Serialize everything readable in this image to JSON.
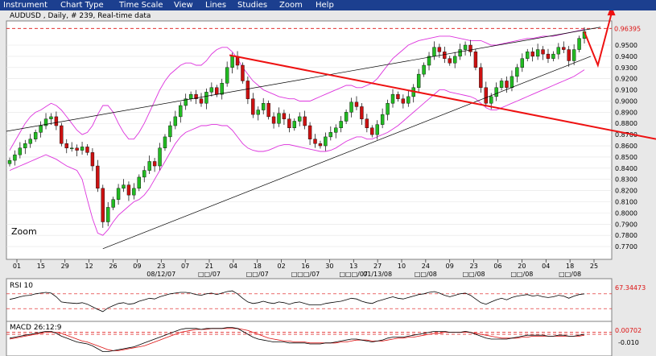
{
  "menu": [
    "Instrument",
    "Chart Type",
    "Time Scale",
    "View",
    "Lines",
    "Studies",
    "Zoom",
    "Help"
  ],
  "chart": {
    "title": "AUDUSD , Daily, # 239, Real-time data",
    "zoom_label": "Zoom",
    "last_price_label": "0.96395",
    "price_ticks": [
      "0.9500",
      "0.9400",
      "0.9300",
      "0.9200",
      "0.9100",
      "0.9000",
      "0.8900",
      "0.8800",
      "0.8700",
      "0.8600",
      "0.8500",
      "0.8400",
      "0.8300",
      "0.8200",
      "0.8100",
      "0.8000",
      "0.7900",
      "0.7800",
      "0.7700"
    ],
    "day_ticks": [
      "01",
      "15",
      "29",
      "12",
      "26",
      "09",
      "23",
      "07",
      "21",
      "04",
      "18",
      "02",
      "16",
      "30",
      "13",
      "27",
      "10",
      "24",
      "09",
      "23",
      "06",
      "20",
      "04",
      "18",
      "25"
    ],
    "month_labels": [
      "08/12/07",
      "□□/07",
      "□□/07",
      "□□□/07",
      "□□□/07",
      "01/13/08",
      "□□/08",
      "□□/08",
      "□□/08",
      "□□/08"
    ],
    "colors": {
      "up": "#22bb22",
      "down": "#cc1111",
      "band": "#dd33dd",
      "trend": "#ee1111",
      "wedge": "#000000"
    }
  },
  "rsi": {
    "label": "RSI 10",
    "value_label": "67.34473"
  },
  "macd": {
    "label": "MACD 26:12:9",
    "value_label": "0.00702",
    "low_label": "-0.010"
  },
  "chart_data": {
    "type": "candlestick",
    "instrument": "AUDUSD",
    "ylim": [
      0.765,
      0.968
    ],
    "closes": [
      0.847,
      0.852,
      0.858,
      0.862,
      0.866,
      0.872,
      0.878,
      0.884,
      0.886,
      0.878,
      0.862,
      0.858,
      0.858,
      0.856,
      0.859,
      0.854,
      0.842,
      0.822,
      0.792,
      0.805,
      0.812,
      0.822,
      0.825,
      0.816,
      0.822,
      0.832,
      0.838,
      0.846,
      0.842,
      0.858,
      0.868,
      0.878,
      0.886,
      0.896,
      0.902,
      0.906,
      0.902,
      0.898,
      0.908,
      0.912,
      0.906,
      0.916,
      0.93,
      0.94,
      0.932,
      0.918,
      0.902,
      0.888,
      0.892,
      0.898,
      0.886,
      0.88,
      0.889,
      0.884,
      0.876,
      0.882,
      0.886,
      0.878,
      0.866,
      0.862,
      0.86,
      0.868,
      0.872,
      0.876,
      0.882,
      0.89,
      0.899,
      0.895,
      0.884,
      0.876,
      0.87,
      0.879,
      0.888,
      0.898,
      0.906,
      0.902,
      0.898,
      0.904,
      0.912,
      0.924,
      0.932,
      0.94,
      0.948,
      0.944,
      0.938,
      0.934,
      0.94,
      0.946,
      0.95,
      0.944,
      0.93,
      0.912,
      0.898,
      0.904,
      0.912,
      0.918,
      0.912,
      0.922,
      0.93,
      0.938,
      0.944,
      0.94,
      0.946,
      0.942,
      0.938,
      0.942,
      0.948,
      0.946,
      0.936,
      0.946,
      0.956,
      0.962
    ],
    "upper_band": [
      0.856,
      0.864,
      0.872,
      0.88,
      0.886,
      0.89,
      0.892,
      0.895,
      0.898,
      0.896,
      0.892,
      0.886,
      0.88,
      0.874,
      0.87,
      0.872,
      0.878,
      0.888,
      0.896,
      0.896,
      0.89,
      0.88,
      0.872,
      0.866,
      0.866,
      0.872,
      0.88,
      0.89,
      0.9,
      0.91,
      0.918,
      0.924,
      0.928,
      0.932,
      0.934,
      0.934,
      0.932,
      0.932,
      0.936,
      0.942,
      0.946,
      0.948,
      0.948,
      0.944,
      0.938,
      0.93,
      0.924,
      0.918,
      0.914,
      0.91,
      0.908,
      0.906,
      0.904,
      0.903,
      0.902,
      0.902,
      0.9,
      0.9,
      0.9,
      0.902,
      0.904,
      0.906,
      0.908,
      0.91,
      0.912,
      0.914,
      0.914,
      0.912,
      0.912,
      0.914,
      0.916,
      0.92,
      0.926,
      0.932,
      0.938,
      0.942,
      0.946,
      0.95,
      0.952,
      0.954,
      0.955,
      0.956,
      0.957,
      0.958,
      0.958,
      0.958,
      0.957,
      0.956,
      0.955,
      0.954,
      0.954,
      0.954,
      0.952,
      0.95,
      0.95,
      0.951,
      0.952,
      0.953,
      0.954,
      0.955,
      0.956,
      0.956,
      0.957,
      0.958,
      0.958,
      0.958,
      0.959,
      0.96,
      0.961,
      0.962,
      0.963,
      0.964
    ],
    "lower_band": [
      0.838,
      0.84,
      0.842,
      0.844,
      0.846,
      0.848,
      0.85,
      0.852,
      0.85,
      0.848,
      0.845,
      0.842,
      0.84,
      0.838,
      0.83,
      0.812,
      0.795,
      0.782,
      0.78,
      0.785,
      0.792,
      0.798,
      0.802,
      0.806,
      0.81,
      0.812,
      0.816,
      0.822,
      0.83,
      0.838,
      0.846,
      0.854,
      0.862,
      0.868,
      0.872,
      0.874,
      0.876,
      0.878,
      0.878,
      0.879,
      0.879,
      0.878,
      0.878,
      0.874,
      0.868,
      0.862,
      0.858,
      0.856,
      0.855,
      0.855,
      0.856,
      0.858,
      0.86,
      0.861,
      0.861,
      0.86,
      0.859,
      0.858,
      0.857,
      0.856,
      0.855,
      0.855,
      0.856,
      0.858,
      0.861,
      0.864,
      0.866,
      0.868,
      0.868,
      0.866,
      0.866,
      0.868,
      0.87,
      0.872,
      0.875,
      0.878,
      0.882,
      0.886,
      0.89,
      0.894,
      0.898,
      0.902,
      0.906,
      0.91,
      0.91,
      0.908,
      0.907,
      0.906,
      0.905,
      0.904,
      0.902,
      0.898,
      0.894,
      0.892,
      0.892,
      0.894,
      0.896,
      0.898,
      0.9,
      0.902,
      0.904,
      0.906,
      0.908,
      0.91,
      0.912,
      0.914,
      0.916,
      0.918,
      0.92,
      0.922,
      0.925,
      0.928
    ],
    "rsi_series": [
      55,
      58,
      62,
      65,
      66,
      70,
      72,
      74,
      72,
      62,
      48,
      46,
      45,
      44,
      46,
      42,
      35,
      28,
      22,
      32,
      38,
      44,
      46,
      42,
      44,
      50,
      54,
      58,
      56,
      62,
      66,
      70,
      72,
      74,
      74,
      72,
      68,
      66,
      70,
      72,
      68,
      72,
      76,
      78,
      70,
      58,
      48,
      44,
      46,
      50,
      46,
      44,
      48,
      46,
      42,
      46,
      48,
      44,
      40,
      40,
      40,
      44,
      46,
      48,
      50,
      54,
      58,
      56,
      50,
      46,
      44,
      50,
      54,
      58,
      62,
      58,
      56,
      60,
      64,
      68,
      70,
      74,
      76,
      72,
      66,
      62,
      66,
      70,
      72,
      66,
      56,
      46,
      42,
      48,
      54,
      58,
      54,
      60,
      64,
      66,
      68,
      64,
      66,
      62,
      60,
      62,
      66,
      64,
      58,
      64,
      68,
      70
    ],
    "macd_series": [
      0.002,
      0.003,
      0.004,
      0.005,
      0.006,
      0.007,
      0.008,
      0.009,
      0.009,
      0.007,
      0.004,
      0.002,
      0.0,
      -0.002,
      -0.003,
      -0.004,
      -0.006,
      -0.009,
      -0.012,
      -0.012,
      -0.011,
      -0.01,
      -0.009,
      -0.008,
      -0.007,
      -0.005,
      -0.003,
      -0.001,
      0.001,
      0.003,
      0.005,
      0.007,
      0.009,
      0.011,
      0.012,
      0.012,
      0.012,
      0.011,
      0.012,
      0.012,
      0.012,
      0.012,
      0.013,
      0.013,
      0.012,
      0.009,
      0.006,
      0.003,
      0.001,
      0.0,
      -0.001,
      -0.002,
      -0.002,
      -0.002,
      -0.003,
      -0.003,
      -0.003,
      -0.003,
      -0.004,
      -0.004,
      -0.004,
      -0.003,
      -0.003,
      -0.002,
      -0.001,
      0.0,
      0.001,
      0.001,
      0.0,
      -0.001,
      -0.002,
      -0.001,
      0.0,
      0.002,
      0.003,
      0.003,
      0.003,
      0.004,
      0.005,
      0.006,
      0.007,
      0.008,
      0.009,
      0.009,
      0.009,
      0.008,
      0.008,
      0.008,
      0.009,
      0.008,
      0.006,
      0.004,
      0.002,
      0.001,
      0.001,
      0.001,
      0.001,
      0.002,
      0.003,
      0.004,
      0.005,
      0.005,
      0.005,
      0.005,
      0.004,
      0.004,
      0.005,
      0.005,
      0.004,
      0.004,
      0.005,
      0.006
    ],
    "macd_signal": [
      0.001,
      0.002,
      0.003,
      0.004,
      0.005,
      0.006,
      0.007,
      0.008,
      0.008,
      0.008,
      0.007,
      0.005,
      0.003,
      0.001,
      -0.001,
      -0.002,
      -0.004,
      -0.006,
      -0.008,
      -0.01,
      -0.011,
      -0.011,
      -0.01,
      -0.009,
      -0.008,
      -0.007,
      -0.006,
      -0.004,
      -0.002,
      0.0,
      0.002,
      0.004,
      0.006,
      0.008,
      0.009,
      0.01,
      0.011,
      0.011,
      0.011,
      0.012,
      0.012,
      0.012,
      0.012,
      0.012,
      0.012,
      0.011,
      0.01,
      0.008,
      0.006,
      0.004,
      0.002,
      0.001,
      0.0,
      -0.001,
      -0.001,
      -0.002,
      -0.002,
      -0.002,
      -0.003,
      -0.003,
      -0.003,
      -0.003,
      -0.003,
      -0.003,
      -0.002,
      -0.002,
      -0.001,
      0.0,
      0.0,
      0.0,
      -0.001,
      -0.001,
      -0.001,
      0.0,
      0.001,
      0.002,
      0.002,
      0.003,
      0.003,
      0.004,
      0.005,
      0.006,
      0.007,
      0.007,
      0.008,
      0.008,
      0.008,
      0.008,
      0.008,
      0.008,
      0.007,
      0.006,
      0.005,
      0.004,
      0.003,
      0.002,
      0.002,
      0.002,
      0.002,
      0.003,
      0.003,
      0.004,
      0.004,
      0.004,
      0.004,
      0.004,
      0.004,
      0.004,
      0.004,
      0.004,
      0.004,
      0.005
    ],
    "rsi_levels": [
      70,
      30
    ],
    "macd_range": [
      -0.014,
      0.016
    ],
    "projection_path": [
      [
        0.962,
        0
      ],
      [
        0.932,
        4
      ],
      [
        0.978,
        8
      ]
    ]
  }
}
